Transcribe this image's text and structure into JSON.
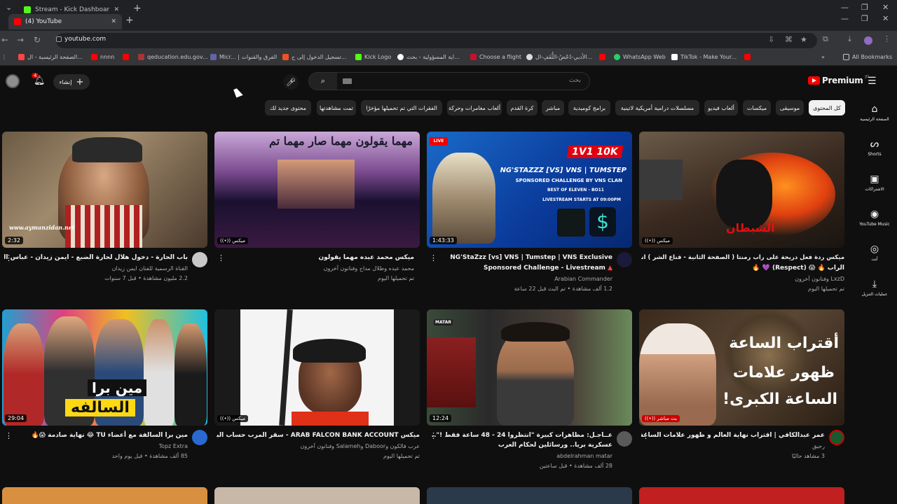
{
  "browser": {
    "tabs": [
      {
        "title": "Stream - Kick Dashboard",
        "favicon_color": "#53fc18"
      },
      {
        "title": "(4) YouTube",
        "favicon_color": "#ff0000"
      }
    ],
    "url": "youtube.com",
    "bookmarks": [
      {
        "label": "الصفحة الرئيسية - ال...",
        "color": "#ff4444"
      },
      {
        "label": "nnnn",
        "color": "#ff0000"
      },
      {
        "label": "qeducation.edu.gov...",
        "color": "#aa3333"
      },
      {
        "label": "Micr... | الفرق والقنوات",
        "color": "#6264a7"
      },
      {
        "label": "تسجيل الدخول إلى ح...",
        "color": "#f25022"
      },
      {
        "label": "Kick Logo",
        "color": "#53fc18"
      },
      {
        "label": "اية المسؤولية - بحث...",
        "color": "#ffffff"
      },
      {
        "label": "Choose a flight",
        "color": "#c8102e"
      },
      {
        "label": "الأدبي-دُحْضُ-الثُّقَفِ-ال...",
        "color": "#dddddd"
      },
      {
        "label": "WhatsApp Web",
        "color": "#25d366"
      },
      {
        "label": "TikTok - Make Your...",
        "color": "#ffffff"
      },
      {
        "label": "All Bookmarks",
        "color": "#c4c7c5"
      }
    ]
  },
  "youtube": {
    "notifications": "4",
    "create_label": "إنشاء",
    "search_placeholder": "بحث",
    "logo_text": "Premium",
    "region": "JO",
    "chips": [
      {
        "label": "كل المحتوى",
        "active": true
      },
      {
        "label": "موسيقى"
      },
      {
        "label": "ميكسات"
      },
      {
        "label": "ألعاب فيديو"
      },
      {
        "label": "مسلسلات درامية أمريكية لاتينية"
      },
      {
        "label": "برامج كوميدية"
      },
      {
        "label": "مباشر"
      },
      {
        "label": "كرة القدم"
      },
      {
        "label": "ألعاب مغامرات وحركة"
      },
      {
        "label": "الفقرات التي تم تحميلها مؤخرًا"
      },
      {
        "label": "تمت مشاهدتها"
      },
      {
        "label": "محتوى جديد لك"
      }
    ],
    "sidebar": [
      {
        "label": "الصفحة الرئيسية",
        "icon": "home-icon"
      },
      {
        "label": "Shorts",
        "icon": "shorts-icon"
      },
      {
        "label": "الاشتراكات",
        "icon": "subscriptions-icon"
      },
      {
        "label": "YouTube Music",
        "icon": "music-icon"
      },
      {
        "label": "أنت",
        "icon": "you-icon"
      },
      {
        "label": "عمليات التنزيل",
        "icon": "download-icon"
      }
    ],
    "videos": [
      {
        "title": "باب الحارة - دخول هلال لحارة الضبع - ايمن زيدان - عباس النوري",
        "channel": "القناة الرسمية للفنان ايمن زيدان",
        "meta": "2.2 مليون مشاهدة • قبل 7 سنوات",
        "duration": "2:32",
        "thumb_text": "www.aymanzidan.net"
      },
      {
        "title": "ميكس محمد عبده مهما يقولون",
        "channel": "محمد عبده وطلال مداح وفنانون آخرون",
        "meta": "تم تحميلها اليوم",
        "badge": "ميكس",
        "thumb_text": "مهما يقولون مهما صار مهما تم"
      },
      {
        "title": "NG'StaZzz [vs] VNS | Tumstep | VNS Exclusive",
        "title2": "Sponsored Challenge - Livestream",
        "channel": "Arabian Commander",
        "meta": "1.2 ألف مشاهدة • تم البث قبل 22 ساعة",
        "duration": "1:43:33",
        "thumb_text": "1V1 10K",
        "thumb_sub": "NG'STAZZZ [VS] VNS | TUMSTEP",
        "thumb_sub2": "SPONSORED CHALLENGE BY VNS CLAN",
        "thumb_sub3": "BEST OF ELEVEN - BO11",
        "thumb_sub4": "LIVESTREAM STARTS AT 09:00PM"
      },
      {
        "title": "ميكس ردة فعل دريحة على راب رمنتا ( الصفحة الثانية - قناع الشر ) انطرب من",
        "title2": "الراب 🔥 😱 (Respect) 💜 🔥",
        "channel": "LxzD وفنانون آخرون",
        "meta": "تم تحميلها اليوم",
        "badge": "ميكس",
        "thumb_text": "الشيطان"
      },
      {
        "title": "مين برا السالفة مع أعضاء TU 😂 نهاية صادمة 😱🔥",
        "channel": "Topz Extra",
        "meta": "85 ألف مشاهدة • قبل يوم واحد",
        "duration": "29:04",
        "thumb_text": "مين برا",
        "thumb_sub": "السالفه"
      },
      {
        "title": "ميكس ARAB FALCON BANK ACCOUNT - سقر المرب حساب البنك",
        "channel": "عرب فالكون وDaboor وSalameh وفنانون آخرون",
        "meta": "تم تحميلها اليوم",
        "badge": "ميكس"
      },
      {
        "title": "عــاجـل: مظاهرات كبيرة \"انتظروا 24 - 48 ساعة فقط !\".. بدء عملية",
        "title2": "عسكرية بريا.. ورسائلين لحكام العرب",
        "channel": "abdelrahman matar",
        "meta": "28 ألف مشاهدة • قبل ساعتين",
        "duration": "12:24",
        "thumb_text": "MATAR"
      },
      {
        "title": "عمر عبدالكافي | اقتراب نهاية العالم و ظهور علامات الساعة الكبرى !!",
        "channel": "رحيق",
        "meta": "3 مشاهد حاليًا",
        "badge": "بث مباشر",
        "thumb_text": "أقتراب الساعة",
        "thumb_sub": "ظهور علامات",
        "thumb_sub2": "الساعة الكبرى!"
      }
    ]
  },
  "colors": {
    "accent": "#ff0000",
    "bg": "#0f0f0f",
    "chip": "#272727"
  }
}
